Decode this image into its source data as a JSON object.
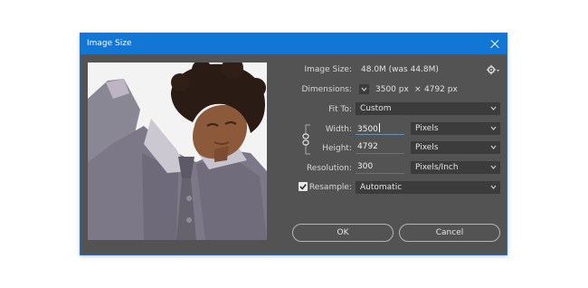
{
  "window": {
    "title": "Image Size"
  },
  "image_size": {
    "label": "Image Size:",
    "value": "48.0M (was 44.8M)"
  },
  "dimensions": {
    "label": "Dimensions:",
    "width": "3500 px",
    "times": "×",
    "height": "4792 px"
  },
  "fit_to": {
    "label": "Fit To:",
    "value": "Custom"
  },
  "width": {
    "label": "Width:",
    "value": "3500",
    "unit": "Pixels"
  },
  "height": {
    "label": "Height:",
    "value": "4792",
    "unit": "Pixels"
  },
  "resolution": {
    "label": "Resolution:",
    "value": "300",
    "unit": "Pixels/Inch"
  },
  "resample": {
    "label": "Resample:",
    "checked": true,
    "value": "Automatic"
  },
  "buttons": {
    "ok": "OK",
    "cancel": "Cancel"
  },
  "colors": {
    "dialog_bg": "#535353",
    "title_bar": "#1176d4",
    "field_bg": "#3c3c3c",
    "focus": "#4f97e3"
  }
}
